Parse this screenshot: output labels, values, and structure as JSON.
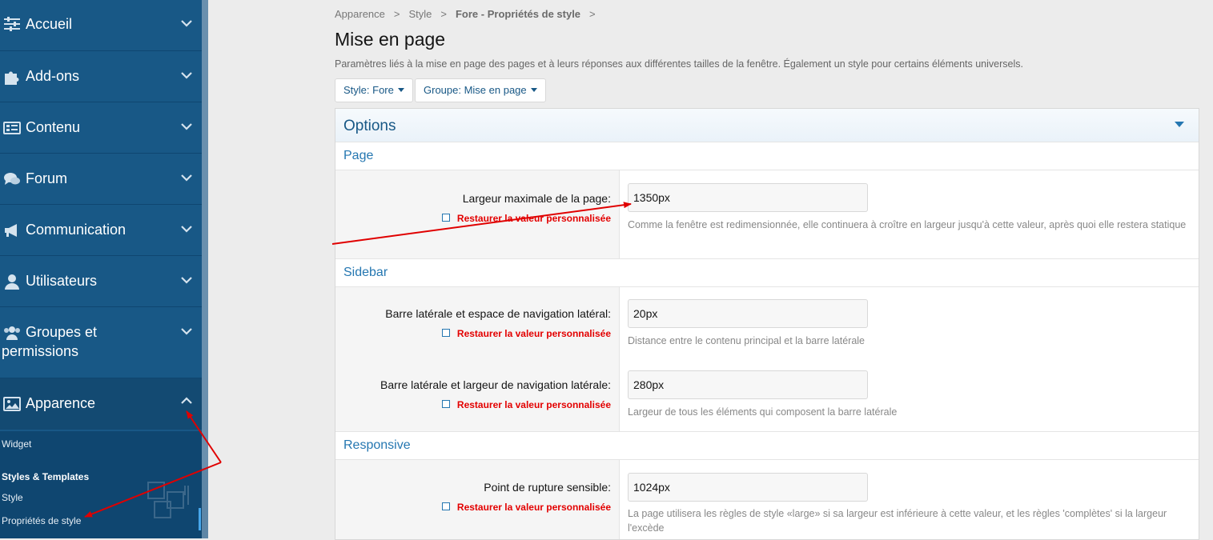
{
  "sidebar": {
    "items": [
      {
        "label": "Accueil",
        "icon": "sliders-icon",
        "name": "accueil"
      },
      {
        "label": "Add-ons",
        "icon": "puzzle-icon",
        "name": "add-ons"
      },
      {
        "label": "Contenu",
        "icon": "content-list-icon",
        "name": "contenu"
      },
      {
        "label": "Forum",
        "icon": "comments-icon",
        "name": "forum"
      },
      {
        "label": "Communication",
        "icon": "bullhorn-icon",
        "name": "communication"
      },
      {
        "label": "Utilisateurs",
        "icon": "user-icon",
        "name": "utilisateurs"
      },
      {
        "label": "Groupes et permissions",
        "icon": "users-icon",
        "name": "groupes"
      },
      {
        "label": "Apparence",
        "icon": "image-icon",
        "name": "apparence"
      }
    ],
    "subitems": {
      "widget": "Widget",
      "styles_heading": "Styles & Templates",
      "style": "Style",
      "style_properties": "Propriétés de style"
    }
  },
  "breadcrumb": [
    "Apparence",
    "Style",
    "Fore - Propriétés de style"
  ],
  "page": {
    "title": "Mise en page",
    "description": "Paramètres liés à la mise en page des pages et à leurs réponses aux différentes tailles de la fenêtre. Également un style pour certains éléments universels."
  },
  "filters": {
    "style": "Style: Fore",
    "group": "Groupe: Mise en page"
  },
  "panel": {
    "title": "Options",
    "revert_label": "Restaurer la valeur personnalisée",
    "sections": {
      "page": "Page",
      "sidebar": "Sidebar",
      "responsive": "Responsive"
    },
    "fields": {
      "max_width": {
        "label": "Largeur maximale de la page:",
        "value": "1350px",
        "hint": "Comme la fenêtre est redimensionnée, elle continuera à croître en largeur jusqu'à cette valeur, après quoi elle restera statique"
      },
      "sidebar_spacing": {
        "label": "Barre latérale et espace de navigation latéral:",
        "value": "20px",
        "hint": "Distance entre le contenu principal et la barre latérale"
      },
      "sidebar_width": {
        "label": "Barre latérale et largeur de navigation latérale:",
        "value": "280px",
        "hint": "Largeur de tous les éléments qui composent la barre latérale"
      },
      "responsive_breakpoint": {
        "label": "Point de rupture sensible:",
        "value": "1024px",
        "hint": "La page utilisera les règles de style «large» si sa largeur est inférieure à cette valeur, et les règles 'complètes' si la largeur l'excède"
      }
    }
  },
  "colors": {
    "sidebar_bg": "#185886",
    "accent": "#2577b1",
    "revert": "#e30000",
    "annotation_arrow": "#e00000"
  }
}
